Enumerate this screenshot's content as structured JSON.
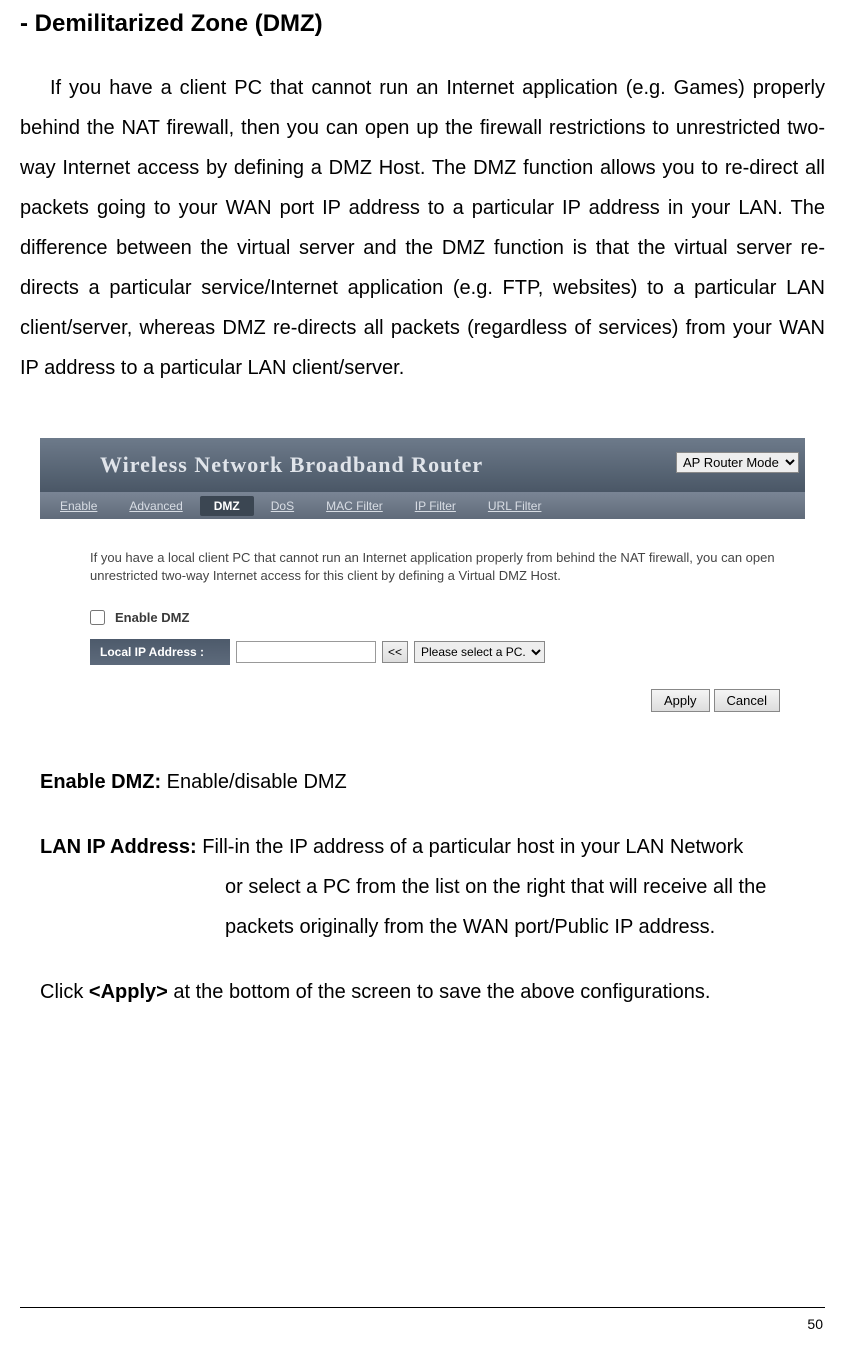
{
  "heading": "- Demilitarized Zone (DMZ)",
  "intro": "If you have a client PC that cannot run an Internet application (e.g. Games) properly behind the NAT firewall, then you can open up the firewall restrictions to unrestricted two-way Internet access by defining a DMZ Host. The DMZ function allows you to re-direct all packets going to your WAN port IP address to a particular IP address in your LAN. The difference between the virtual server and the DMZ function is that the virtual server re-directs a particular service/Internet application (e.g. FTP, websites) to a particular LAN client/server, whereas DMZ re-directs all packets (regardless of services) from your WAN IP address to a particular LAN client/server.",
  "router": {
    "title": "Wireless Network Broadband Router",
    "mode_selected": "AP Router Mode",
    "tabs": [
      "Enable",
      "Advanced",
      "DMZ",
      "DoS",
      "MAC Filter",
      "IP Filter",
      "URL Filter"
    ],
    "active_tab": "DMZ",
    "help": "If you have a local client PC that cannot run an Internet application properly from behind the NAT firewall, you can open unrestricted two-way Internet access for this client by defining a Virtual DMZ Host.",
    "enable_label": "Enable DMZ",
    "field_label": "Local IP Address :",
    "assign_btn": "<<",
    "pc_placeholder": "Please select a PC.",
    "apply": "Apply",
    "cancel": "Cancel"
  },
  "desc": {
    "enable_label": "Enable DMZ:",
    "enable_text": " Enable/disable DMZ",
    "lan_label": "LAN IP Address:",
    "lan_text_1": " Fill-in the IP address of a particular host in your LAN Network",
    "lan_text_2": "or select a PC from the list on the right that will receive all the",
    "lan_text_3": "packets originally from the WAN port/Public IP address.",
    "apply_prefix": "Click ",
    "apply_label": "<Apply>",
    "apply_suffix": " at the bottom of the screen to save the above configurations."
  },
  "page_number": "50"
}
